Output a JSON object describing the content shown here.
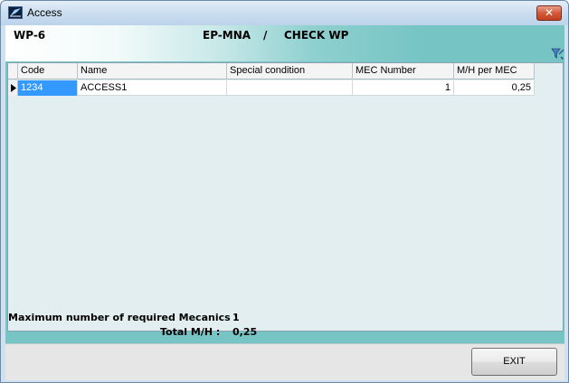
{
  "window": {
    "title": "Access",
    "close_glyph": "✕"
  },
  "header": {
    "wp_code": "WP-6",
    "registration": "EP-MNA",
    "separator": "/",
    "check_type": "CHECK WP"
  },
  "grid": {
    "columns": [
      "Code",
      "Name",
      "Special condition",
      "MEC Number",
      "M/H per MEC"
    ],
    "rows": [
      {
        "code": "1234",
        "name": "ACCESS1",
        "special_condition": "",
        "mec_number": "1",
        "mh_per_mec": "0,25"
      }
    ]
  },
  "summary": {
    "max_mechanics_label": "Maximum number of required Mecanics :",
    "max_mechanics_value": "1",
    "total_mh_label": "Total M/H :",
    "total_mh_value": "0,25"
  },
  "footer": {
    "exit_label": "EXIT"
  },
  "icons": {
    "app": "app-icon",
    "filter": "filter-icon",
    "row_indicator": "row-indicator-arrow-icon"
  },
  "colors": {
    "client_bg": "#76c4c4",
    "selected_cell": "#3399ff",
    "close_button": "#c2401f"
  }
}
